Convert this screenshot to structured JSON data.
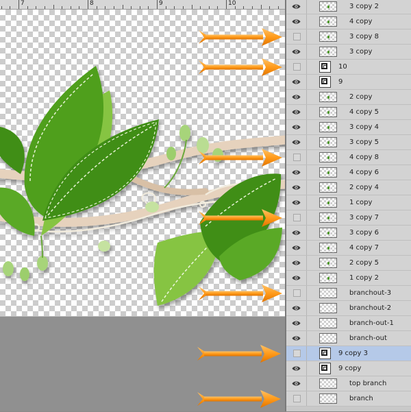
{
  "ruler": {
    "labels": [
      {
        "text": "7"
      },
      {
        "text": "8"
      },
      {
        "text": "9"
      },
      {
        "text": "10"
      }
    ]
  },
  "colors": {
    "leaf_dark": "#3f8e16",
    "leaf_mid": "#5aa928",
    "leaf_light": "#86c443",
    "branch": "#e6d2bd",
    "arrow": "#ff9a1a",
    "selected_row": "#b5c9e8"
  },
  "layers": [
    {
      "name": "3 copy 2",
      "visible": true,
      "kind": "pixel"
    },
    {
      "name": "4 copy",
      "visible": true,
      "kind": "pixel"
    },
    {
      "name": "3 copy 8",
      "visible": false,
      "kind": "pixel"
    },
    {
      "name": "3 copy",
      "visible": true,
      "kind": "pixel"
    },
    {
      "name": "10",
      "visible": false,
      "kind": "smart"
    },
    {
      "name": "9",
      "visible": true,
      "kind": "smart"
    },
    {
      "name": "2 copy",
      "visible": true,
      "kind": "pixel"
    },
    {
      "name": "4 copy 5",
      "visible": true,
      "kind": "pixel"
    },
    {
      "name": "3 copy 4",
      "visible": true,
      "kind": "pixel"
    },
    {
      "name": "3 copy 5",
      "visible": true,
      "kind": "pixel"
    },
    {
      "name": "4 copy 8",
      "visible": false,
      "kind": "pixel"
    },
    {
      "name": "4 copy 6",
      "visible": true,
      "kind": "pixel"
    },
    {
      "name": "2 copy 4",
      "visible": true,
      "kind": "pixel"
    },
    {
      "name": "1 copy",
      "visible": true,
      "kind": "pixel"
    },
    {
      "name": "3 copy 7",
      "visible": false,
      "kind": "pixel"
    },
    {
      "name": "3 copy 6",
      "visible": true,
      "kind": "pixel"
    },
    {
      "name": "4 copy 7",
      "visible": true,
      "kind": "pixel"
    },
    {
      "name": "2 copy 5",
      "visible": true,
      "kind": "pixel"
    },
    {
      "name": "1 copy 2",
      "visible": true,
      "kind": "pixel"
    },
    {
      "name": "branchout-3",
      "visible": false,
      "kind": "pixel"
    },
    {
      "name": "branchout-2",
      "visible": true,
      "kind": "pixel"
    },
    {
      "name": "branch-out-1",
      "visible": true,
      "kind": "pixel"
    },
    {
      "name": "branch-out",
      "visible": true,
      "kind": "pixel"
    },
    {
      "name": "9 copy 3",
      "visible": false,
      "kind": "smart",
      "selected": true
    },
    {
      "name": "9 copy",
      "visible": true,
      "kind": "smart"
    },
    {
      "name": "top branch",
      "visible": true,
      "kind": "pixel"
    },
    {
      "name": "branch",
      "visible": false,
      "kind": "pixel"
    }
  ],
  "annotation_arrows": [
    {
      "points_to": "3 copy 8"
    },
    {
      "points_to": "10"
    },
    {
      "points_to": "4 copy 8"
    },
    {
      "points_to": "3 copy 7"
    },
    {
      "points_to": "branchout-3"
    },
    {
      "points_to": "9 copy 3"
    },
    {
      "points_to": "branch"
    }
  ]
}
